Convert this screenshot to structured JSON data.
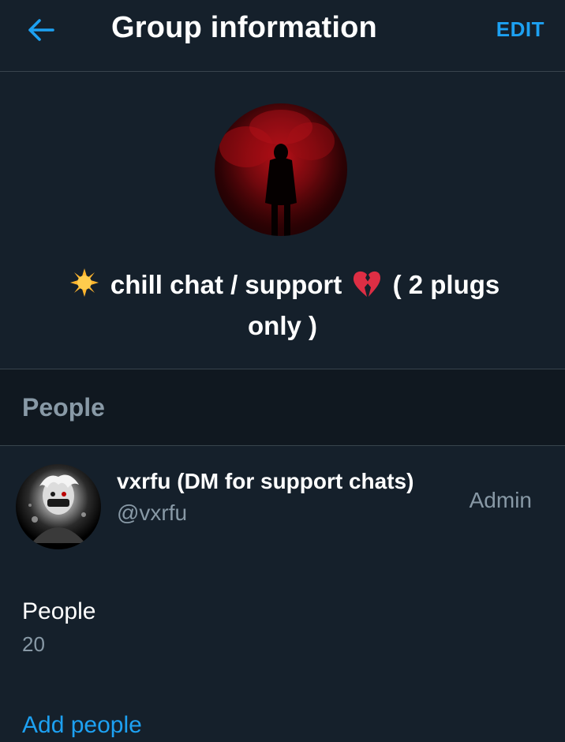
{
  "header": {
    "title": "Group information",
    "edit_label": "EDIT",
    "back_icon": "arrow-left-icon",
    "accent_color": "#1da1f2"
  },
  "group": {
    "name_part1": "chill chat / support",
    "name_part2": "( 2 plugs only )",
    "leading_emoji": "sun-emoji-icon",
    "trailing_emoji": "broken-heart-emoji-icon"
  },
  "people_section": {
    "title": "People"
  },
  "members": [
    {
      "display_name": "vxrfu (DM for support chats)",
      "handle": "@vxrfu",
      "role": "Admin"
    }
  ],
  "people_count": {
    "label": "People",
    "value": "20"
  },
  "actions": {
    "add_people_label": "Add people"
  },
  "colors": {
    "background": "#15202b",
    "section_background": "#101820",
    "divider": "#38444d",
    "secondary_text": "#8899a6",
    "primary_text": "#ffffff"
  }
}
